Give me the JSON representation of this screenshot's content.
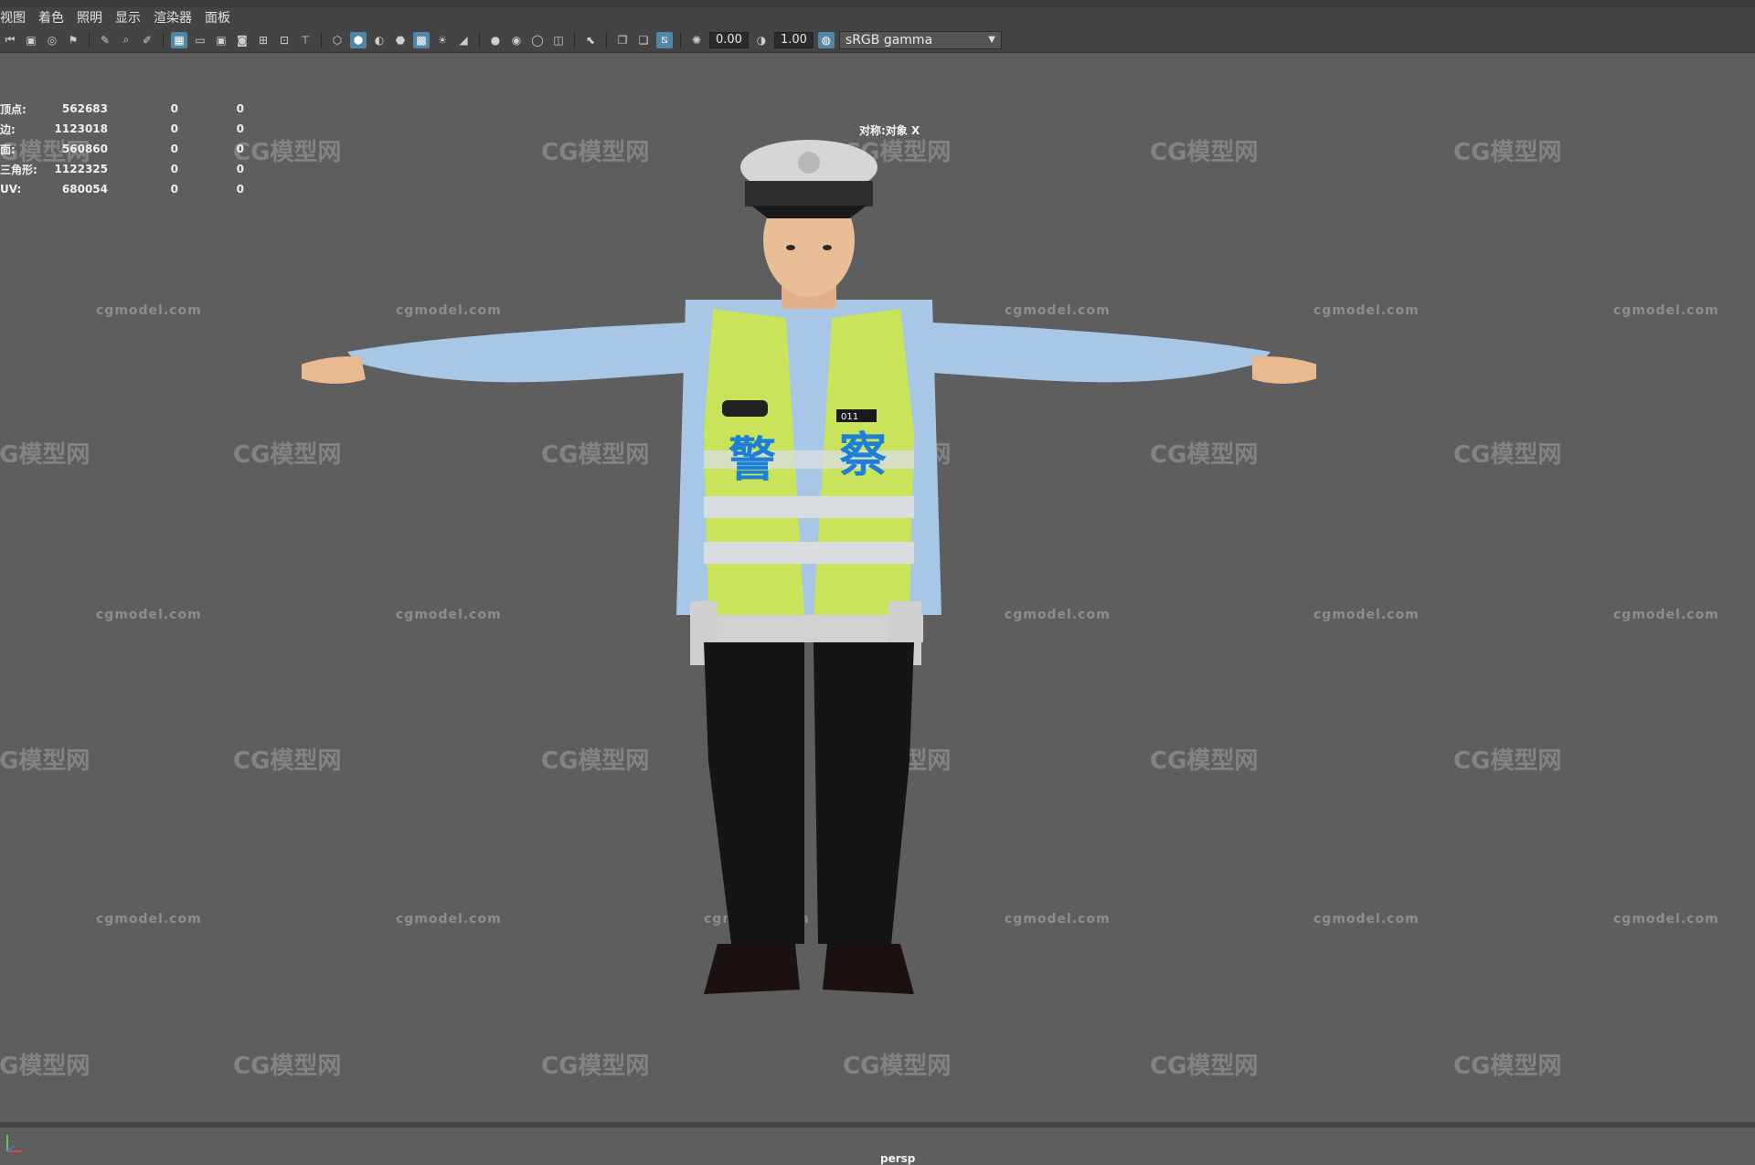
{
  "menu": {
    "items": [
      "视图",
      "着色",
      "照明",
      "显示",
      "渲染器",
      "面板"
    ]
  },
  "toolbar": {
    "exposure_value": "0.00",
    "gamma_value": "1.00",
    "color_space": "sRGB gamma"
  },
  "hud": {
    "rows": [
      {
        "label": "顶点:",
        "v1": "562683",
        "v2": "0",
        "v3": "0"
      },
      {
        "label": "边:",
        "v1": "1123018",
        "v2": "0",
        "v3": "0"
      },
      {
        "label": "面:",
        "v1": "560860",
        "v2": "0",
        "v3": "0"
      },
      {
        "label": "三角形:",
        "v1": "1122325",
        "v2": "0",
        "v3": "0"
      },
      {
        "label": "UV:",
        "v1": "680054",
        "v2": "0",
        "v3": "0"
      }
    ]
  },
  "viewport": {
    "symmetry": "对称:对象 X",
    "camera": "persp"
  },
  "watermark": {
    "site": "cgmodel.com",
    "logo": "CG模型网"
  },
  "model_text": {
    "vest_left": "警",
    "vest_right": "察",
    "badge_number": "011"
  },
  "colors": {
    "viewport_bg": "#5e5e5e",
    "active_button": "#5285a6",
    "vest": "#c9e35a",
    "shirt": "#a8c6e6"
  }
}
